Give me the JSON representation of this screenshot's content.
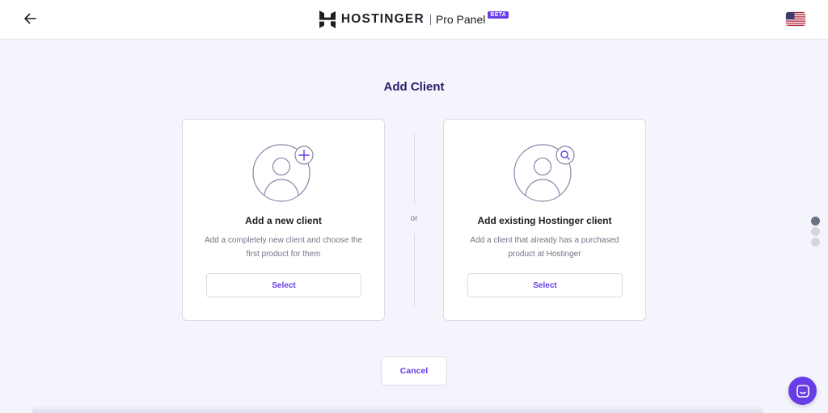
{
  "header": {
    "brand": "HOSTINGER",
    "panel": "Pro Panel",
    "badge": "BETA",
    "icons": {
      "back": "arrow-left-icon",
      "logo": "hostinger-logo",
      "language": "us-flag-icon"
    }
  },
  "page": {
    "title": "Add Client"
  },
  "options": [
    {
      "title": "Add a new client",
      "description": "Add a completely new client and choose the first product for them",
      "button": "Select",
      "icon": "user-plus-icon"
    },
    {
      "title": "Add existing Hostinger client",
      "description": "Add a client that already has a purchased product at Hostinger",
      "button": "Select",
      "icon": "user-search-icon"
    }
  ],
  "separator": "or",
  "footer": {
    "cancel": "Cancel"
  },
  "side_nav": {
    "dots": 3,
    "active": 0
  },
  "chat": {
    "icon": "chat-icon"
  },
  "colors": {
    "accent": "#673de6",
    "heading": "#2f1c6a",
    "text": "#1d1e20",
    "muted": "#727586",
    "background": "#f4f4fc"
  }
}
